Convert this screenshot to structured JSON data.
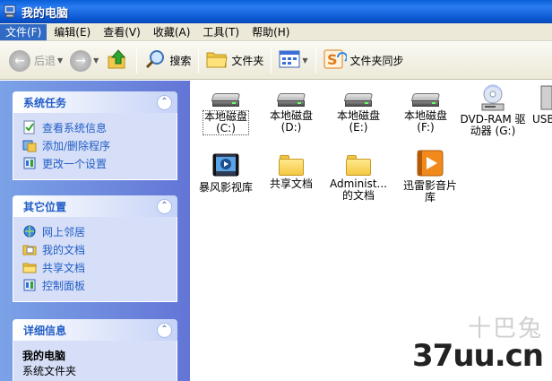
{
  "window": {
    "title": "我的电脑"
  },
  "menu": [
    "文件(F)",
    "编辑(E)",
    "查看(V)",
    "收藏(A)",
    "工具(T)",
    "帮助(H)"
  ],
  "toolbar": {
    "back": "后退",
    "search": "搜索",
    "folders": "文件夹",
    "folder_sync": "文件夹同步"
  },
  "sidebar": {
    "system_tasks": {
      "title": "系统任务",
      "items": [
        "查看系统信息",
        "添加/删除程序",
        "更改一个设置"
      ]
    },
    "other_places": {
      "title": "其它位置",
      "items": [
        "网上邻居",
        "我的文档",
        "共享文档",
        "控制面板"
      ]
    },
    "details": {
      "title": "详细信息",
      "name": "我的电脑",
      "desc": "系统文件夹"
    }
  },
  "items": {
    "drive_c": [
      "本地磁盘",
      "(C:)"
    ],
    "drive_d": [
      "本地磁盘",
      "(D:)"
    ],
    "drive_e": [
      "本地磁盘",
      "(E:)"
    ],
    "drive_f": [
      "本地磁盘",
      "(F:)"
    ],
    "dvd": [
      "DVD-RAM 驱",
      "动器 (G:)"
    ],
    "usb": "USB",
    "storm": "暴风影视库",
    "shared": "共享文档",
    "admin": [
      "Administ...",
      "的文档"
    ],
    "xunlei": [
      "迅雷影音片",
      "库"
    ]
  },
  "watermark": {
    "cn": "十巴兔",
    "en": "37uu.cn"
  },
  "colors": {
    "accent": "#215dc6",
    "titlebar": "#0b56d0",
    "annotation": "#e8392a"
  }
}
